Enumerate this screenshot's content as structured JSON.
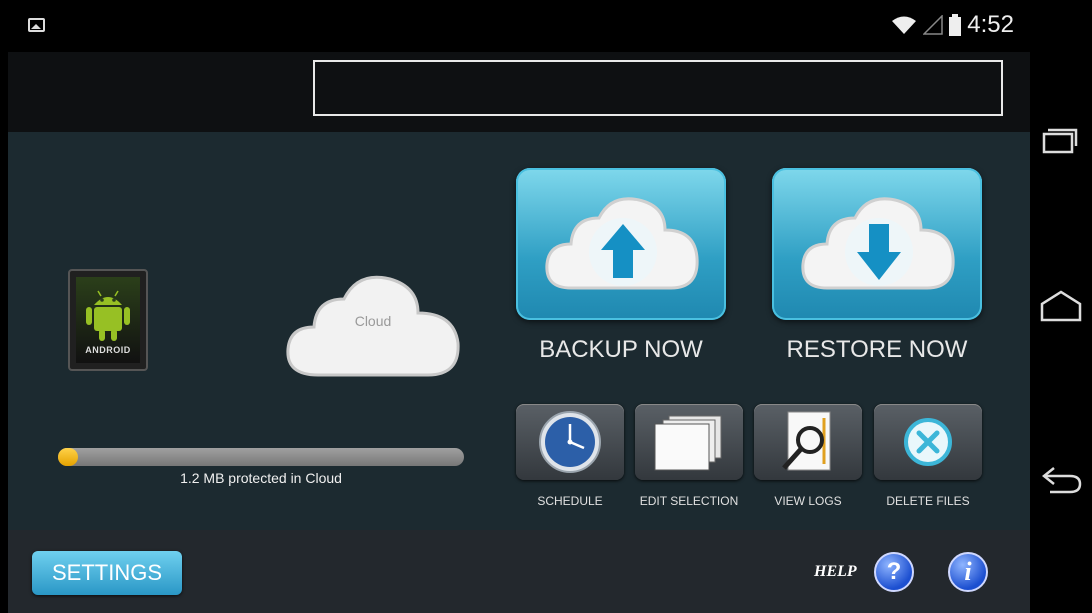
{
  "status_bar": {
    "time": "4:52"
  },
  "main": {
    "device_label": "ANDROID",
    "cloud_label": "Cloud",
    "backup_label": "BACKUP NOW",
    "restore_label": "RESTORE NOW",
    "progress_text": "1.2 MB protected in Cloud",
    "progress_fraction": 0.04,
    "tools": [
      {
        "label": "SCHEDULE",
        "icon": "clock-icon"
      },
      {
        "label": "EDIT SELECTION",
        "icon": "documents-icon"
      },
      {
        "label": "VIEW LOGS",
        "icon": "magnifier-log-icon"
      },
      {
        "label": "DELETE FILES",
        "icon": "delete-x-icon"
      }
    ]
  },
  "footer": {
    "settings_label": "SETTINGS",
    "help_label": "HELP",
    "help_icon_glyph": "?",
    "info_icon_glyph": "i"
  },
  "colors": {
    "accent": "#2f9fc4",
    "progress_fill": "#f2b800"
  }
}
